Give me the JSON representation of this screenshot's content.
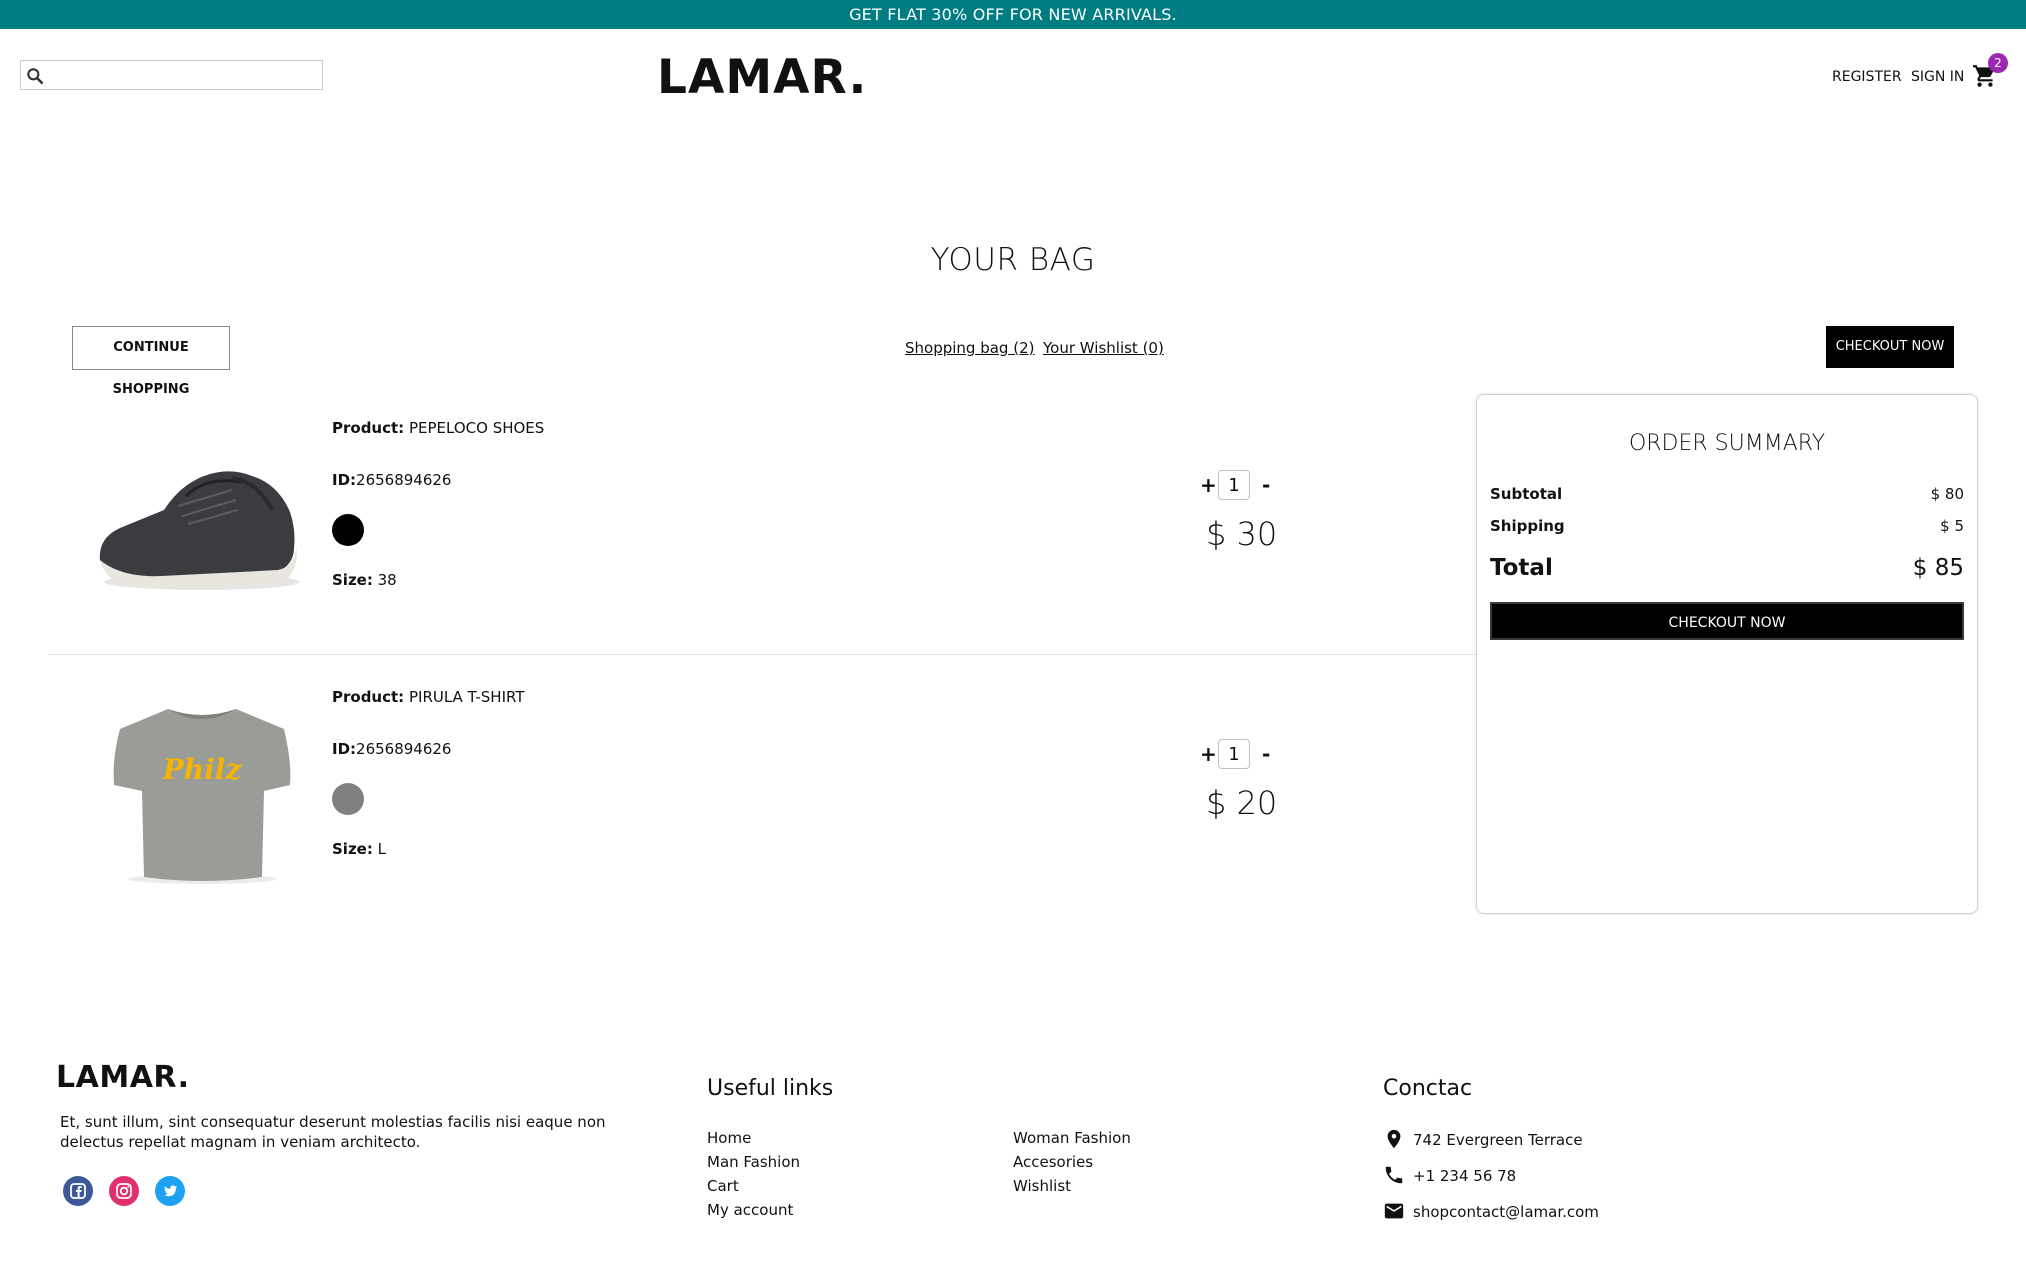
{
  "announcement": "GET FLAT 30% OFF FOR NEW ARRIVALS.",
  "header": {
    "search_placeholder": "",
    "logo": "LAMAR.",
    "register": "REGISTER",
    "sign_in": "SIGN IN",
    "cart_count": "2",
    "cart_icon": "shopping-cart-icon",
    "badge_color": "#9c27b0"
  },
  "page": {
    "title": "YOUR BAG",
    "continue_shopping": "CONTINUE SHOPPING",
    "shopping_bag_link": "Shopping bag (2)",
    "wishlist_link": "Your Wishlist (0)",
    "checkout": "CHECKOUT NOW"
  },
  "products": [
    {
      "product_label": "Product:",
      "name": "PEPELOCO SHOES",
      "id_label": "ID:",
      "id": "2656894626",
      "color": "#000000",
      "size_label": "Size:",
      "size": "38",
      "quantity": "1",
      "price": "$ 30",
      "image_icon": "sneaker-image"
    },
    {
      "product_label": "Product:",
      "name": "PIRULA T-SHIRT",
      "id_label": "ID:",
      "id": "2656894626",
      "color": "#808080",
      "size_label": "Size:",
      "size": "L",
      "quantity": "1",
      "price": "$ 20",
      "image_icon": "tshirt-image",
      "image_text": "Philz"
    }
  ],
  "summary": {
    "title": "ORDER SUMMARY",
    "subtotal_label": "Subtotal",
    "subtotal": "$ 80",
    "shipping_label": "Shipping",
    "shipping": "$ 5",
    "total_label": "Total",
    "total": "$ 85",
    "checkout": "CHECKOUT NOW"
  },
  "footer": {
    "logo": "LAMAR.",
    "description": "Et, sunt illum, sint consequatur deserunt molestias facilis nisi eaque non delectus repellat magnam in veniam architecto.",
    "social": [
      "facebook-icon",
      "instagram-icon",
      "twitter-icon"
    ],
    "useful_links_title": "Useful links",
    "links_col1": [
      "Home",
      "Man Fashion",
      "Cart",
      "My account"
    ],
    "links_col2": [
      "Woman Fashion",
      "Accesories",
      "Wishlist"
    ],
    "contact_title": "Conctac",
    "address": "742 Evergreen Terrace",
    "phone": "+1 234 56 78",
    "email": "shopcontact@lamar.com"
  },
  "colors": {
    "announcement_bg": "#007d82",
    "primary_button": "#000000",
    "facebook": "#3b5998",
    "instagram": "#e1306c",
    "twitter": "#1da1f2"
  }
}
